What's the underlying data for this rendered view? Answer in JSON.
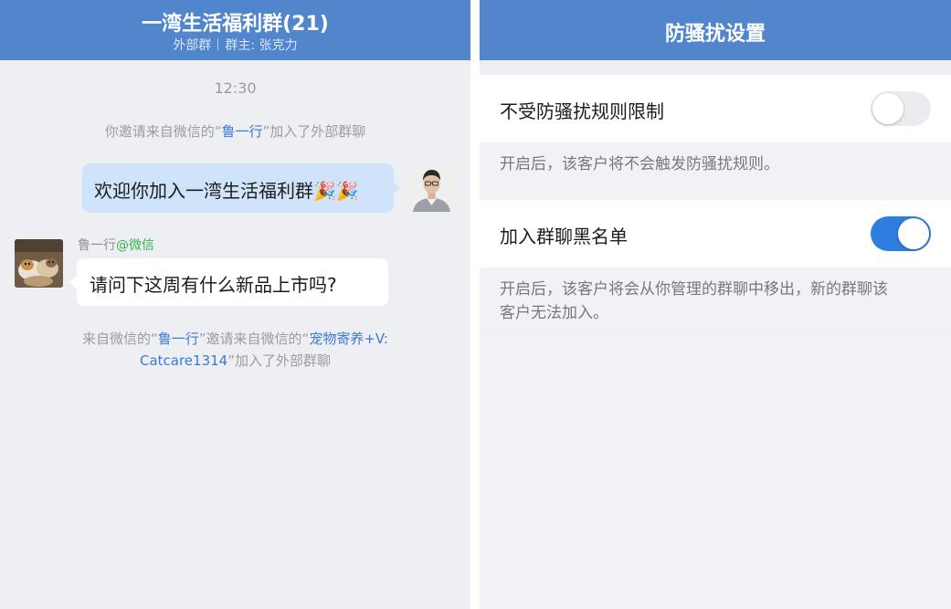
{
  "chat": {
    "title": "一湾生活福利群(21)",
    "subtitle_type": "外部群",
    "subtitle_owner": "群主: 张克力",
    "time": "12:30",
    "sys1_prefix": "你邀请来自微信的“",
    "sys1_name": "鲁一行",
    "sys1_suffix": "”加入了外部群聊",
    "msg_out": "欢迎你加入一湾生活福利群🎉🎉",
    "sender_name": "鲁一行",
    "sender_source": "@微信",
    "msg_in": "请问下这周有什么新品上市吗?",
    "sys2_prefix": "来自微信的“",
    "sys2_name1": "鲁一行",
    "sys2_mid": "”邀请来自微信的“",
    "sys2_name2_line1": "宠物寄养+V:",
    "sys2_name2_line2": "Catcare1314",
    "sys2_suffix": "”加入了外部群聊"
  },
  "settings": {
    "title": "防骚扰设置",
    "items": [
      {
        "label": "不受防骚扰规则限制",
        "enabled": false,
        "desc": "开启后，该客户将不会触发防骚扰规则。"
      },
      {
        "label": "加入群聊黑名单",
        "enabled": true,
        "desc_line1": "开启后，该客户将会从你管理的群聊中移出，新的群聊该",
        "desc_line2": "客户无法加入。"
      }
    ]
  },
  "colors": {
    "header_bg": "#5186cd",
    "link": "#3a7ad8",
    "wechat_green": "#36b34a",
    "toggle_on": "#2e7de0",
    "bubble_out": "#cfe4fb"
  },
  "icons": {
    "avatar_me": "man-with-glasses-avatar",
    "avatar_other": "cats-photo-avatar"
  }
}
